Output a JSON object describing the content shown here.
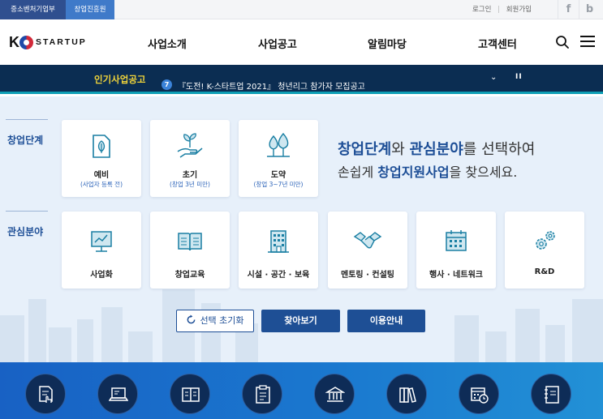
{
  "topbar": {
    "tab_business": "중소벤처기업부",
    "tab_agency": "창업진흥원",
    "login": "로그인",
    "separator": "|",
    "join": "회원가입",
    "facebook": "f",
    "blog": "b"
  },
  "header": {
    "logo_k": "K",
    "logo_text": "STARTUP",
    "nav": [
      "사업소개",
      "사업공고",
      "알림마당",
      "고객센터"
    ]
  },
  "ticker": {
    "label": "인기사업공고",
    "number": "7",
    "text": "『도전! K-스타트업 2021』 청년리그 참가자 모집공고",
    "down": "⌄",
    "pause": "II"
  },
  "stage": {
    "label": "창업단계",
    "items": [
      {
        "name": "예비",
        "sub": "(사업자 등록 전)",
        "icon": "document-leaf-icon"
      },
      {
        "name": "초기",
        "sub": "(창업 3년 미만)",
        "icon": "hand-sprout-icon"
      },
      {
        "name": "도약",
        "sub": "(창업 3~7년 미만)",
        "icon": "trees-icon"
      }
    ]
  },
  "interest": {
    "label": "관심분야",
    "items": [
      {
        "name": "사업화",
        "icon": "chart-board-icon"
      },
      {
        "name": "창업교육",
        "icon": "open-book-icon"
      },
      {
        "name": "시설 · 공간 · 보육",
        "icon": "building-icon"
      },
      {
        "name": "멘토링 · 컨설팅",
        "icon": "handshake-icon"
      },
      {
        "name": "행사 · 네트워크",
        "icon": "calendar-icon"
      },
      {
        "name": "R&D",
        "icon": "gears-icon"
      }
    ]
  },
  "headline": {
    "hl1": "창업단계",
    "t1": "와 ",
    "hl2": "관심분야",
    "t2": "를 선택하여",
    "t3": "손쉽게 ",
    "hl3": "창업지원사업",
    "t4": "을 찾으세요."
  },
  "buttons": {
    "reset": "선택 초기화",
    "search": "찾아보기",
    "guide": "이용안내"
  },
  "quick_icons": [
    "document-hand-icon",
    "laptop-icon",
    "book-icon",
    "clipboard-icon",
    "bank-icon",
    "books-icon",
    "calendar-clock-icon",
    "notebook-icon"
  ],
  "colors": {
    "navy": "#0b2d52",
    "brand_blue": "#1d4e96",
    "ticker_yellow": "#f0d43a",
    "accent_teal": "#0e9fb5",
    "bottom_blue": "#1a78cf"
  }
}
